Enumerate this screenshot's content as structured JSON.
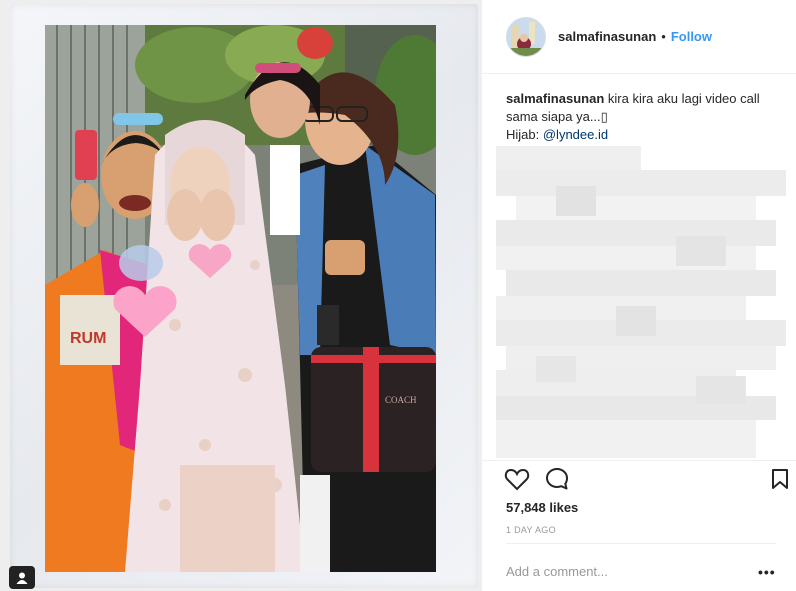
{
  "post": {
    "username": "salmafinasunan",
    "separator": "•",
    "follow_label": "Follow",
    "caption": {
      "username": "salmafinasunan",
      "text": "kira kira aku lagi video call sama siapa ya...",
      "emoji_placeholder": "▯",
      "hijab_label": "Hijab: ",
      "mention": "@lyndee.id"
    },
    "likes_text": "57,848 likes",
    "time_ago": "1 DAY AGO",
    "comment_placeholder": "Add a comment...",
    "more_label": "•••"
  },
  "icons": {
    "like": "heart-outline-icon",
    "comment": "speech-bubble-icon",
    "save": "bookmark-icon",
    "user_tag": "person-tag-icon"
  },
  "colors": {
    "accent": "#3897f0",
    "text": "#262626",
    "muted": "#999999",
    "mention": "#003569",
    "border": "#efefef"
  }
}
